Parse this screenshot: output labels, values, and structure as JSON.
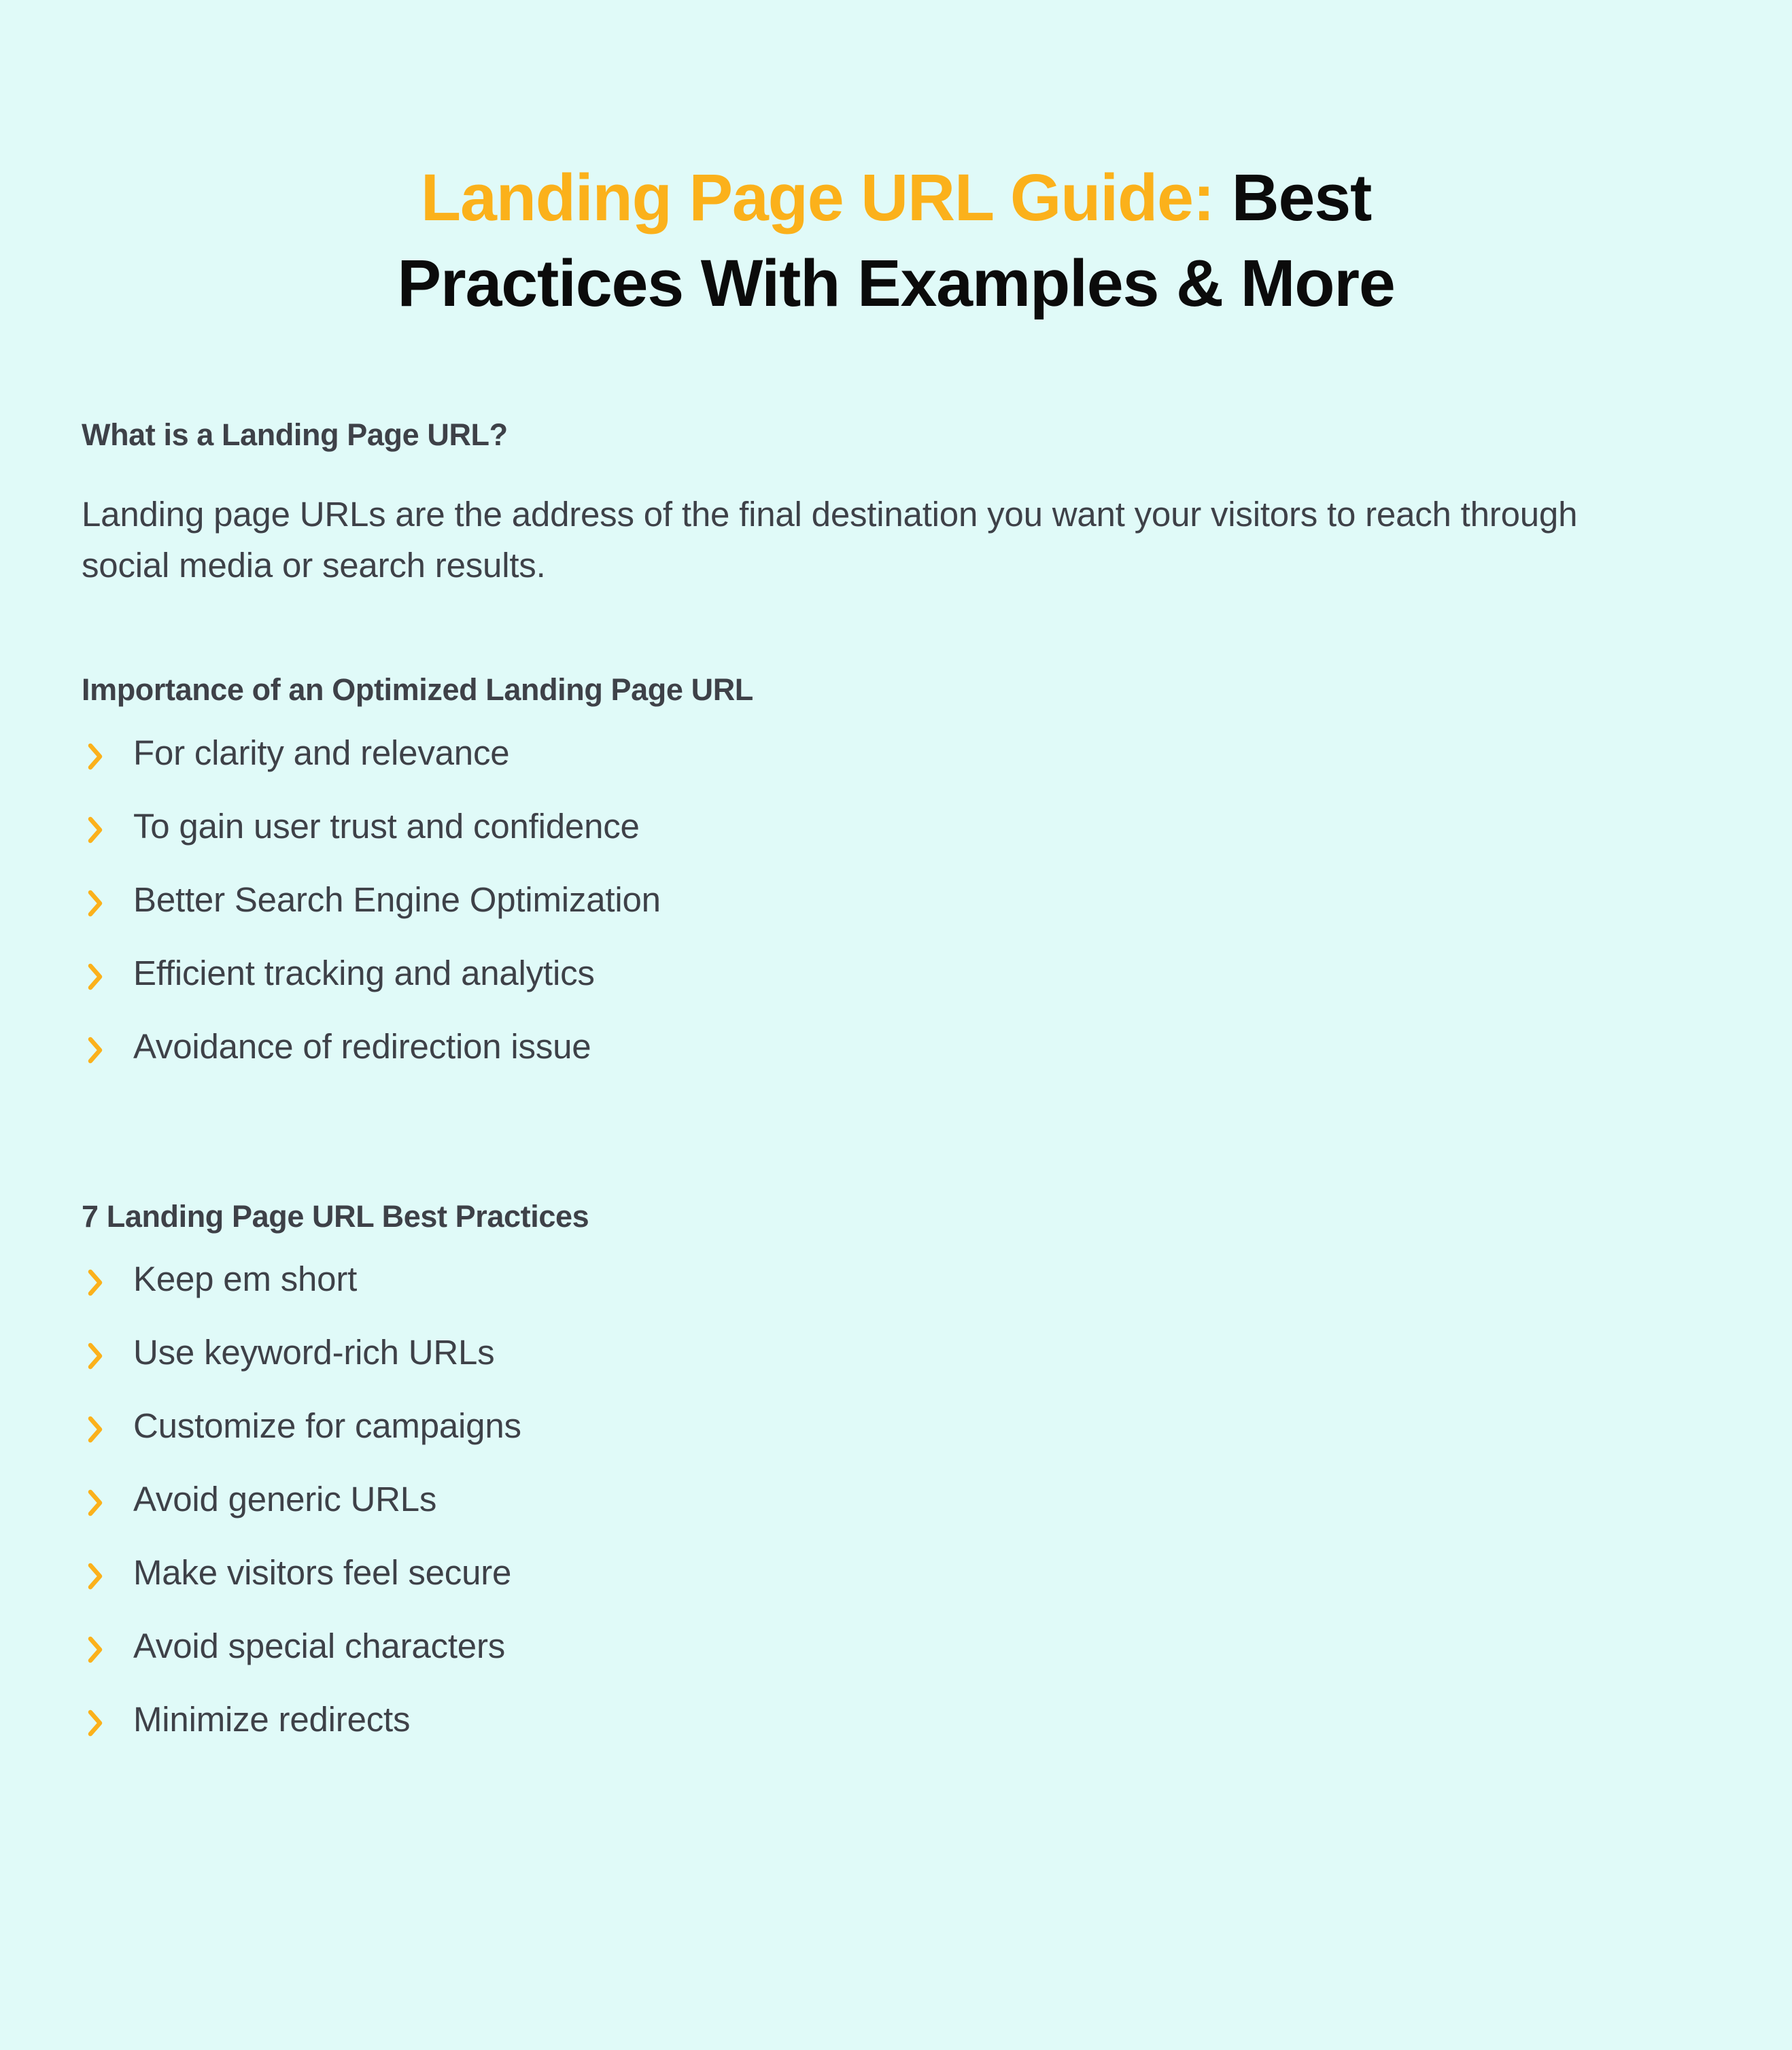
{
  "colors": {
    "background": "#e0faf8",
    "accent_orange": "#fbb11b",
    "title_black": "#0b0b0b",
    "body_gray": "#3e4148"
  },
  "title": {
    "line1_accent": "Landing Page URL Guide:",
    "line1_rest": " Best",
    "line2": "Practices With Examples & More"
  },
  "sections": [
    {
      "heading": "What is a Landing Page URL?",
      "paragraph": "Landing page URLs are the address of the final destination you want your visitors to reach through social media or search results."
    },
    {
      "heading": "Importance of an Optimized Landing Page URL",
      "items": [
        "For clarity and relevance",
        "To gain user trust and confidence",
        "Better Search Engine Optimization",
        "Efficient tracking and analytics",
        "Avoidance of redirection issue"
      ]
    },
    {
      "heading": "7 Landing Page URL Best Practices",
      "items": [
        "Keep em short",
        "Use keyword-rich URLs",
        "Customize for campaigns",
        "Avoid generic URLs",
        "Make visitors feel secure",
        "Avoid special characters",
        "Minimize redirects"
      ]
    }
  ]
}
